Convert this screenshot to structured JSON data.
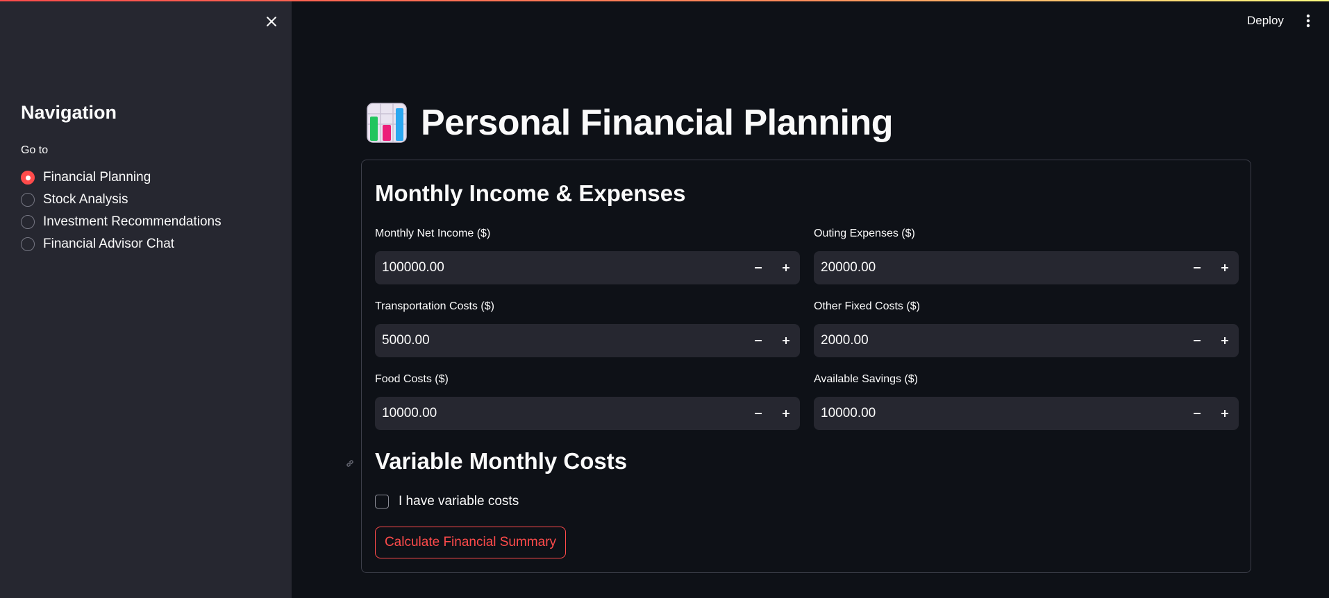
{
  "app": {
    "accent_color": "#ff4b4b",
    "background": "#0e1117",
    "sidebar_background": "#262730"
  },
  "header": {
    "deploy_label": "Deploy",
    "menu_icon": "vertical-dots-icon"
  },
  "sidebar": {
    "close_icon": "close-icon",
    "title": "Navigation",
    "radio_label": "Go to",
    "options": [
      {
        "label": "Financial Planning",
        "selected": true
      },
      {
        "label": "Stock Analysis",
        "selected": false
      },
      {
        "label": "Investment Recommendations",
        "selected": false
      },
      {
        "label": "Financial Advisor Chat",
        "selected": false
      }
    ]
  },
  "main": {
    "title_icon": "bar-chart-emoji-icon",
    "title": "Personal Financial Planning",
    "income_section": {
      "heading": "Monthly Income & Expenses",
      "fields": [
        {
          "label": "Monthly Net Income ($)",
          "value": "100000.00"
        },
        {
          "label": "Outing Expenses ($)",
          "value": "20000.00"
        },
        {
          "label": "Transportation Costs ($)",
          "value": "5000.00"
        },
        {
          "label": "Other Fixed Costs ($)",
          "value": "2000.00"
        },
        {
          "label": "Food Costs ($)",
          "value": "10000.00"
        },
        {
          "label": "Available Savings ($)",
          "value": "10000.00"
        }
      ]
    },
    "variable_section": {
      "heading": "Variable Monthly Costs",
      "checkbox_label": "I have variable costs",
      "checkbox_checked": false
    },
    "calculate_button": "Calculate Financial Summary"
  }
}
